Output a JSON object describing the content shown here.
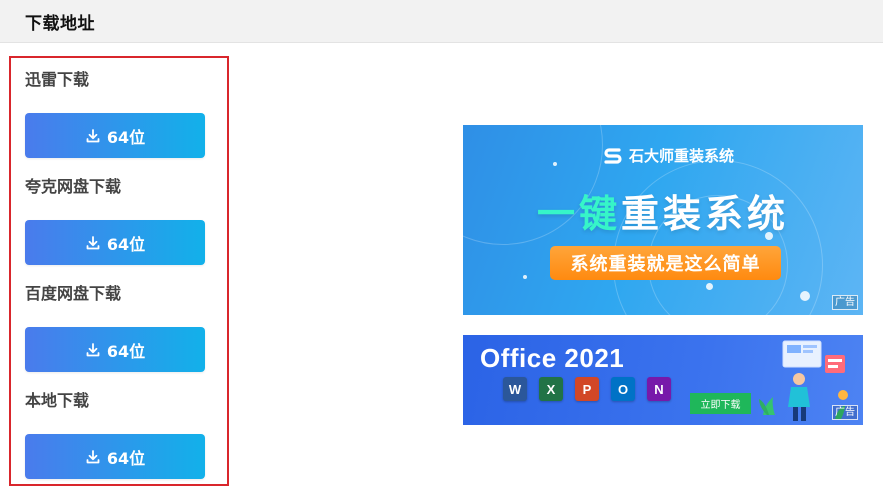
{
  "header": {
    "title": "下载地址"
  },
  "downloads": [
    {
      "label": "迅雷下载",
      "button": "64位"
    },
    {
      "label": "夸克网盘下载",
      "button": "64位"
    },
    {
      "label": "百度网盘下载",
      "button": "64位"
    },
    {
      "label": "本地下载",
      "button": "64位"
    }
  ],
  "ad_reinstall": {
    "brand": "石大师重装系统",
    "headline_highlight": "一键",
    "headline_rest": "重装系统",
    "slogan": "系统重装就是这么简单",
    "ad_tag": "广告"
  },
  "ad_office": {
    "title": "Office 2021",
    "apps": [
      {
        "letter": "W",
        "color": "#2b579a"
      },
      {
        "letter": "X",
        "color": "#217346"
      },
      {
        "letter": "P",
        "color": "#d24726"
      },
      {
        "letter": "O",
        "color": "#0072c6"
      },
      {
        "letter": "N",
        "color": "#7719aa"
      }
    ],
    "button": "立即下载",
    "ad_tag": "广告"
  },
  "colors": {
    "button_gradient_start": "#4a7bec",
    "button_gradient_end": "#12b1ea",
    "panel_border": "#d9262c"
  }
}
